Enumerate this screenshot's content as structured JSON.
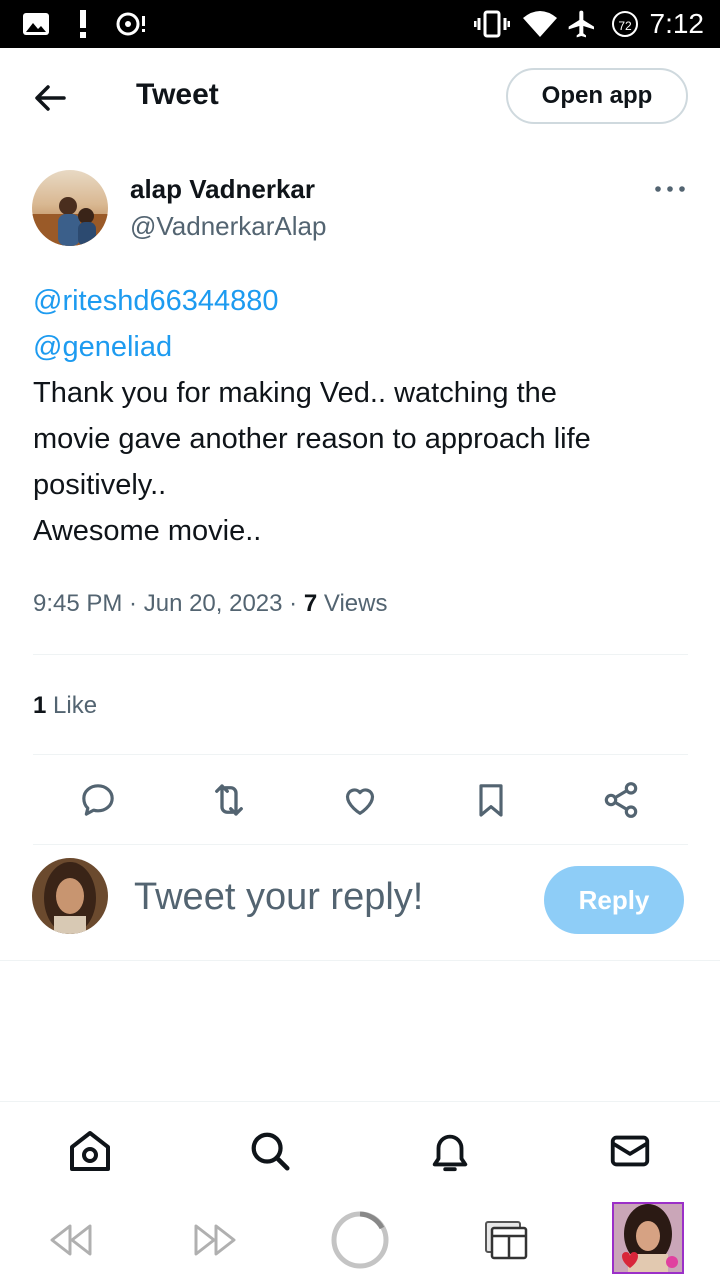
{
  "status_bar": {
    "time": "7:12",
    "battery_level": "72"
  },
  "header": {
    "title": "Tweet",
    "open_app_label": "Open app"
  },
  "tweet": {
    "author_name": "alap Vadnerkar",
    "author_handle": "@VadnerkarAlap",
    "mentions": [
      "@riteshd66344880",
      "@geneliad"
    ],
    "body_lines": [
      "Thank you for making Ved.. watching the",
      "movie gave another reason to approach life",
      "positively..",
      "Awesome movie.."
    ],
    "time": "9:45 PM",
    "date": "Jun 20, 2023",
    "views_count": "7",
    "views_label": "Views",
    "likes_count": "1",
    "likes_label": "Like"
  },
  "reply_box": {
    "placeholder": "Tweet your reply!",
    "button_label": "Reply"
  },
  "colors": {
    "accent": "#1d9bf0",
    "reply_button": "#8ecdf7",
    "secondary_text": "#536471"
  },
  "icons": {
    "header": [
      "back-arrow-icon",
      "more-options-icon"
    ],
    "actions": [
      "reply-icon",
      "retweet-icon",
      "like-icon",
      "bookmark-icon",
      "share-icon"
    ],
    "bottom_nav": [
      "home-icon",
      "search-icon",
      "notifications-icon",
      "messages-icon"
    ],
    "browser_bar": [
      "rewind-icon",
      "fast-forward-icon",
      "reload-icon",
      "tabs-icon",
      "profile-thumbnail"
    ]
  }
}
